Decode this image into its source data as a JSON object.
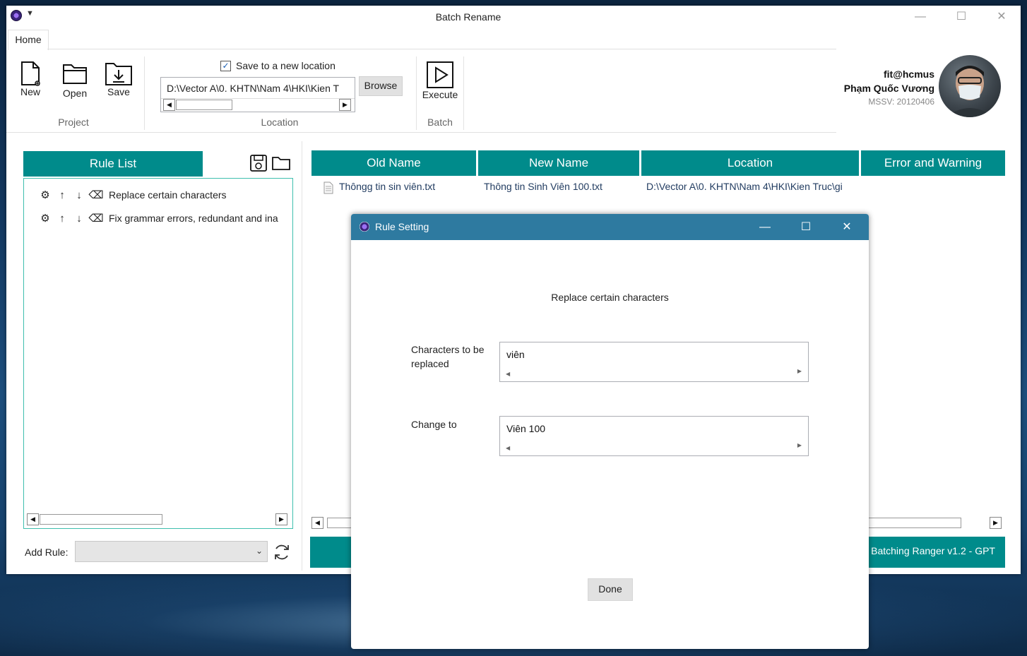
{
  "window": {
    "title": "Batch Rename"
  },
  "ribbon": {
    "tab_home": "Home",
    "new_label": "New",
    "open_label": "Open",
    "save_label": "Save",
    "project_group": "Project",
    "save_new_location_label": "Save to a new location",
    "save_new_location_checked": true,
    "location_path": "D:\\Vector A\\0. KHTN\\Nam 4\\HKI\\Kien T",
    "browse_label": "Browse",
    "location_group": "Location",
    "execute_label": "Execute",
    "batch_group": "Batch"
  },
  "user": {
    "handle": "fit@hcmus",
    "name": "Phạm Quốc Vương",
    "student_id": "MSSV: 20120406"
  },
  "rule_list": {
    "title": "Rule List",
    "items": [
      {
        "label": "Replace certain characters"
      },
      {
        "label": "Fix grammar errors, redundant and ina"
      }
    ]
  },
  "file_table": {
    "columns": [
      "Old Name",
      "New Name",
      "Location",
      "Error and Warning"
    ],
    "rows": [
      {
        "old_name": "Thôngg tin sin viên.txt",
        "new_name": "Thông tin Sinh Viên 100.txt",
        "location": "D:\\Vector A\\0. KHTN\\Nam 4\\HKI\\Kien Truc\\gi",
        "error": ""
      }
    ]
  },
  "add_rule": {
    "label": "Add Rule:",
    "selected": ""
  },
  "footer": {
    "version": "Batching Ranger v1.2 - GPT"
  },
  "dialog": {
    "title": "Rule Setting",
    "heading": "Replace certain characters",
    "field1_label": "Characters to be replaced",
    "field1_value": "viên",
    "field2_label": "Change to",
    "field2_value": "Viên 100",
    "done_label": "Done"
  }
}
